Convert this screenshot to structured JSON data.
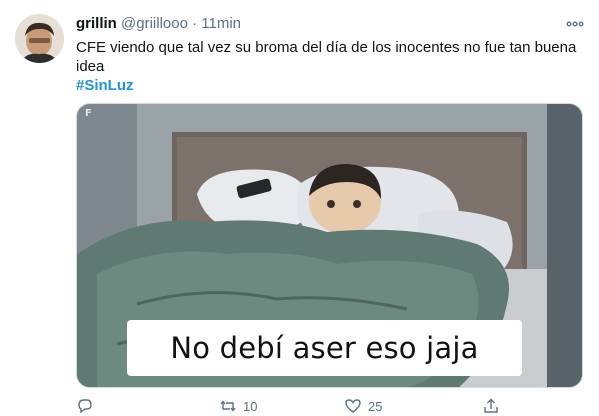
{
  "tweet": {
    "author_name": "grillin",
    "handle": "@griillooo",
    "separator": "·",
    "time": "11min",
    "text": "CFE viendo que tal vez su broma del día de los inocentes no fue tan buena idea",
    "hashtag": "#SinLuz",
    "media": {
      "caption": "No debí aser eso jaja",
      "watermark": "F"
    }
  },
  "actions": {
    "reply": {
      "icon": "reply-icon",
      "count": ""
    },
    "retweet": {
      "icon": "retweet-icon",
      "count": "10"
    },
    "like": {
      "icon": "heart-icon",
      "count": "25"
    },
    "share": {
      "icon": "share-icon",
      "count": ""
    }
  },
  "colors": {
    "link": "#1b95e0",
    "muted": "#5b7083",
    "text": "#0f1419"
  }
}
